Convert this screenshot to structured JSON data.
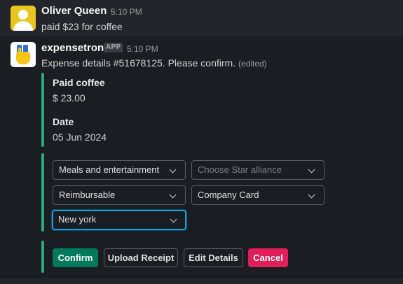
{
  "messages": [
    {
      "author": "Oliver Queen",
      "time": "5:10 PM",
      "text": "paid $23 for coffee"
    },
    {
      "author": "expensetron",
      "badge": "APP",
      "time": "5:10 PM",
      "text": "Expense details #51678125. Please confirm.",
      "edited": "(edited)"
    }
  ],
  "details": {
    "paid_label": "Paid coffee",
    "paid_value": "$ 23.00",
    "date_label": "Date",
    "date_value": "05 Jun 2024"
  },
  "selects": {
    "category": "Meals and entertainment",
    "alliance_placeholder": "Choose Star alliance",
    "reimbursable": "Reimbursable",
    "payment": "Company Card",
    "location": "New york"
  },
  "actions": {
    "confirm": "Confirm",
    "upload": "Upload Receipt",
    "edit": "Edit Details",
    "cancel": "Cancel"
  },
  "colors": {
    "accent_bar": "#2bac76",
    "confirm": "#007a5a",
    "cancel": "#e01e5a",
    "focus": "#1d9bd1"
  }
}
